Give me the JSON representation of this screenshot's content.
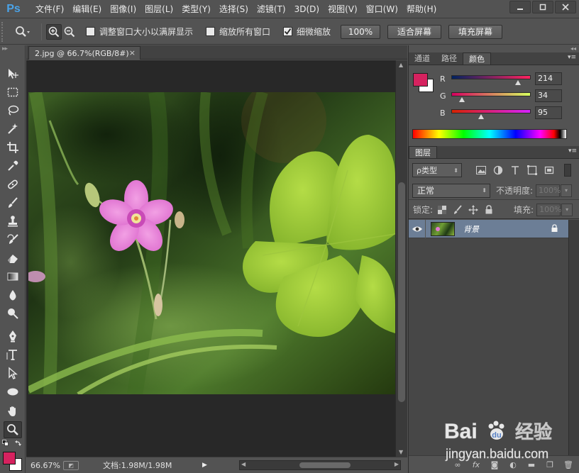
{
  "app": {
    "logo": "Ps",
    "menu": [
      "文件(F)",
      "编辑(E)",
      "图像(I)",
      "图层(L)",
      "类型(Y)",
      "选择(S)",
      "滤镜(T)",
      "3D(D)",
      "视图(V)",
      "窗口(W)",
      "帮助(H)"
    ]
  },
  "options": {
    "resize_windows_label": "调整窗口大小以满屏显示",
    "zoom_all_label": "缩放所有窗口",
    "scrubby_zoom_label": "细微缩放",
    "scrubby_zoom_checked": true,
    "btn_100": "100%",
    "btn_fit": "适合屏幕",
    "btn_fill": "填充屏幕"
  },
  "document": {
    "tab_title": "2.jpg @ 66.7%(RGB/8#)",
    "tab_close": "×",
    "zoom": "66.67%",
    "doc_info": "文档:1.98M/1.98M"
  },
  "color_panel": {
    "tabs": [
      "通道",
      "路径",
      "颜色"
    ],
    "active_tab": 2,
    "foreground": "#d6225f",
    "background": "#ffffff",
    "r_label": "R",
    "r_value": "214",
    "g_label": "G",
    "g_value": "34",
    "b_label": "B",
    "b_value": "95"
  },
  "layers_panel": {
    "tab": "图层",
    "filter_kind": "ρ类型",
    "blend_mode": "正常",
    "opacity_label": "不透明度:",
    "opacity_value": "100%",
    "lock_label": "锁定:",
    "fill_label": "填充:",
    "fill_value": "100%",
    "layers": [
      {
        "name": "背景",
        "visible": true,
        "locked": true
      }
    ]
  },
  "watermark": {
    "brand": "Bai",
    "brand2": "经验",
    "url": "jingyan.baidu.com"
  }
}
